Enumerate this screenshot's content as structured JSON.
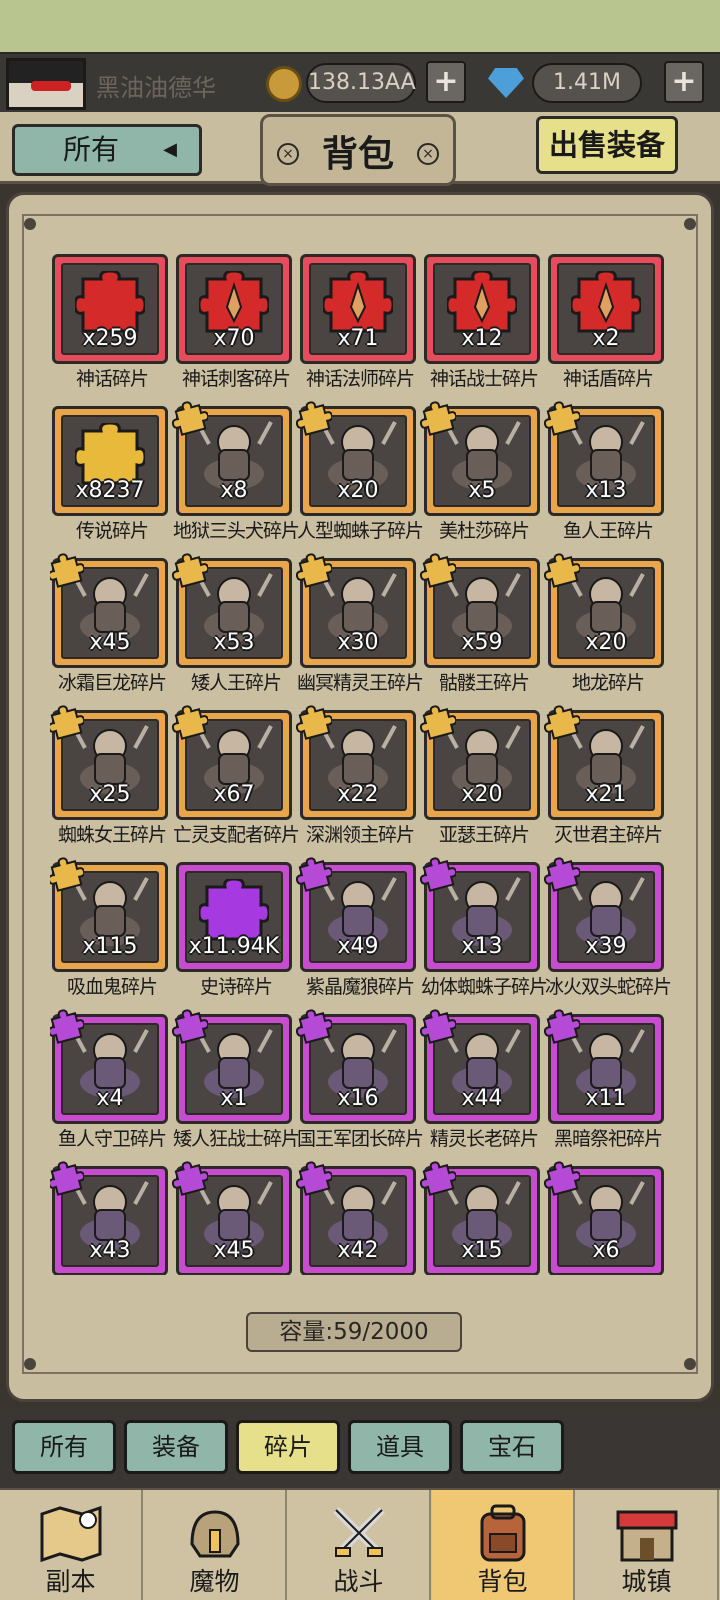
{
  "player": {
    "name": "黑油油德华",
    "gold": "138.13AA",
    "diamonds": "1.41M",
    "plus": "+"
  },
  "header": {
    "filter_label": "所有",
    "title": "背包",
    "sell_label": "出售装备",
    "close": "×"
  },
  "colors": {
    "mythic": "#e64c5c",
    "legendary": "#e8a54a",
    "epic": "#c84ccf",
    "active_tab": "#e7e08a",
    "tab": "#8fb6a8"
  },
  "items": [
    {
      "count": "x259",
      "name": "神话碎片",
      "rarity": "red",
      "icon": "puzzle-icon"
    },
    {
      "count": "x70",
      "name": "神话刺客碎片",
      "rarity": "red",
      "icon": "dagger-puzzle-icon"
    },
    {
      "count": "x71",
      "name": "神话法师碎片",
      "rarity": "red",
      "icon": "staff-puzzle-icon"
    },
    {
      "count": "x12",
      "name": "神话战士碎片",
      "rarity": "red",
      "icon": "sword-puzzle-icon"
    },
    {
      "count": "x2",
      "name": "神话盾碎片",
      "rarity": "red",
      "icon": "shield-puzzle-icon"
    },
    {
      "count": "x8237",
      "name": "传说碎片",
      "rarity": "orange",
      "icon": "puzzle-icon"
    },
    {
      "count": "x8",
      "name": "地狱三头犬碎片",
      "rarity": "orange",
      "icon": "monster-icon"
    },
    {
      "count": "x20",
      "name": "人型蜘蛛子碎片",
      "rarity": "orange",
      "icon": "monster-icon"
    },
    {
      "count": "x5",
      "name": "美杜莎碎片",
      "rarity": "orange",
      "icon": "monster-icon"
    },
    {
      "count": "x13",
      "name": "鱼人王碎片",
      "rarity": "orange",
      "icon": "monster-icon"
    },
    {
      "count": "x45",
      "name": "冰霜巨龙碎片",
      "rarity": "orange",
      "icon": "monster-icon"
    },
    {
      "count": "x53",
      "name": "矮人王碎片",
      "rarity": "orange",
      "icon": "monster-icon"
    },
    {
      "count": "x30",
      "name": "幽冥精灵王碎片",
      "rarity": "orange",
      "icon": "monster-icon"
    },
    {
      "count": "x59",
      "name": "骷髅王碎片",
      "rarity": "orange",
      "icon": "monster-icon"
    },
    {
      "count": "x20",
      "name": "地龙碎片",
      "rarity": "orange",
      "icon": "monster-icon"
    },
    {
      "count": "x25",
      "name": "蜘蛛女王碎片",
      "rarity": "orange",
      "icon": "monster-icon"
    },
    {
      "count": "x67",
      "name": "亡灵支配者碎片",
      "rarity": "orange",
      "icon": "monster-icon"
    },
    {
      "count": "x22",
      "name": "深渊领主碎片",
      "rarity": "orange",
      "icon": "monster-icon"
    },
    {
      "count": "x20",
      "name": "亚瑟王碎片",
      "rarity": "orange",
      "icon": "monster-icon"
    },
    {
      "count": "x21",
      "name": "灭世君主碎片",
      "rarity": "orange",
      "icon": "monster-icon"
    },
    {
      "count": "x115",
      "name": "吸血鬼碎片",
      "rarity": "orange",
      "icon": "monster-icon"
    },
    {
      "count": "x11.94K",
      "name": "史诗碎片",
      "rarity": "purple",
      "icon": "puzzle-icon"
    },
    {
      "count": "x49",
      "name": "紫晶魔狼碎片",
      "rarity": "purple",
      "icon": "monster-icon"
    },
    {
      "count": "x13",
      "name": "幼体蜘蛛子碎片",
      "rarity": "purple",
      "icon": "monster-icon"
    },
    {
      "count": "x39",
      "name": "冰火双头蛇碎片",
      "rarity": "purple",
      "icon": "monster-icon"
    },
    {
      "count": "x4",
      "name": "鱼人守卫碎片",
      "rarity": "purple",
      "icon": "monster-icon"
    },
    {
      "count": "x1",
      "name": "矮人狂战士碎片",
      "rarity": "purple",
      "icon": "monster-icon"
    },
    {
      "count": "x16",
      "name": "国王军团长碎片",
      "rarity": "purple",
      "icon": "monster-icon"
    },
    {
      "count": "x44",
      "name": "精灵长老碎片",
      "rarity": "purple",
      "icon": "monster-icon"
    },
    {
      "count": "x11",
      "name": "黑暗祭祀碎片",
      "rarity": "purple",
      "icon": "monster-icon"
    },
    {
      "count": "x43",
      "name": "",
      "rarity": "purple",
      "icon": "monster-icon"
    },
    {
      "count": "x45",
      "name": "",
      "rarity": "purple",
      "icon": "monster-icon"
    },
    {
      "count": "x42",
      "name": "",
      "rarity": "purple",
      "icon": "monster-icon"
    },
    {
      "count": "x15",
      "name": "",
      "rarity": "purple",
      "icon": "monster-icon"
    },
    {
      "count": "x6",
      "name": "",
      "rarity": "purple",
      "icon": "monster-icon"
    }
  ],
  "capacity": "容量:59/2000",
  "tabs": [
    {
      "label": "所有",
      "active": false
    },
    {
      "label": "装备",
      "active": false
    },
    {
      "label": "碎片",
      "active": true
    },
    {
      "label": "道具",
      "active": false
    },
    {
      "label": "宝石",
      "active": false
    }
  ],
  "nav": [
    {
      "label": "副本",
      "icon": "map-icon",
      "active": false
    },
    {
      "label": "魔物",
      "icon": "helmet-icon",
      "active": false
    },
    {
      "label": "战斗",
      "icon": "crossed-swords-icon",
      "active": false
    },
    {
      "label": "背包",
      "icon": "backpack-icon",
      "active": true
    },
    {
      "label": "城镇",
      "icon": "shop-icon",
      "active": false
    }
  ]
}
